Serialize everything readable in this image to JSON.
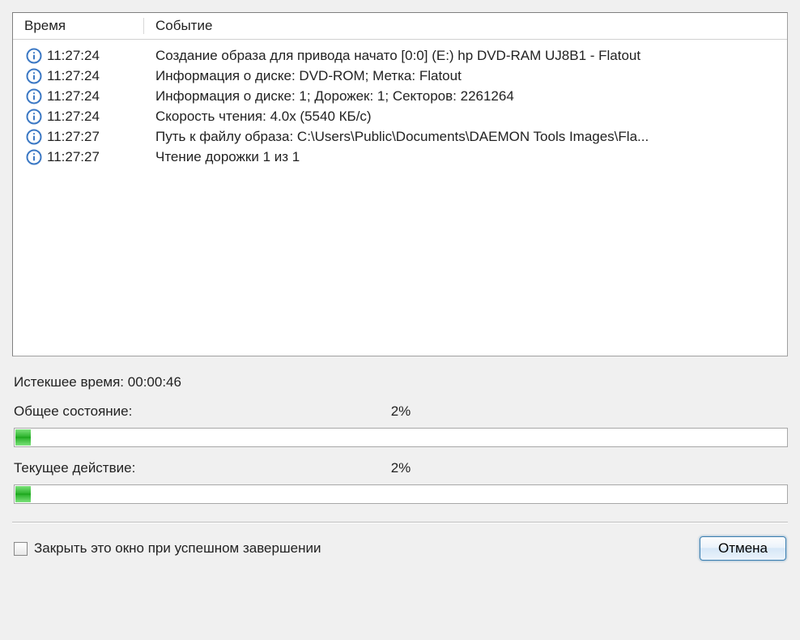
{
  "headers": {
    "time": "Время",
    "event": "Событие"
  },
  "log": [
    {
      "time": "11:27:24",
      "event": "Создание образа для привода начато [0:0] (E:) hp DVD-RAM UJ8B1 - Flatout"
    },
    {
      "time": "11:27:24",
      "event": "Информация о диске: DVD-ROM; Метка: Flatout"
    },
    {
      "time": "11:27:24",
      "event": "Информация о диске: 1; Дорожек: 1; Секторов: 2261264"
    },
    {
      "time": "11:27:24",
      "event": "Скорость чтения: 4.0x (5540 КБ/с)"
    },
    {
      "time": "11:27:27",
      "event": "Путь к файлу образа: C:\\Users\\Public\\Documents\\DAEMON Tools Images\\Fla..."
    },
    {
      "time": "11:27:27",
      "event": "Чтение дорожки 1 из 1"
    }
  ],
  "elapsed": {
    "label": "Истекшее время:",
    "value": "00:00:46"
  },
  "overall": {
    "label": "Общее состояние:",
    "percent_text": "2%",
    "percent_value": 2
  },
  "current": {
    "label": "Текущее действие:",
    "percent_text": "2%",
    "percent_value": 2
  },
  "closeOnSuccess": {
    "label": "Закрыть это окно при успешном завершении",
    "checked": false
  },
  "cancel_label": "Отмена"
}
